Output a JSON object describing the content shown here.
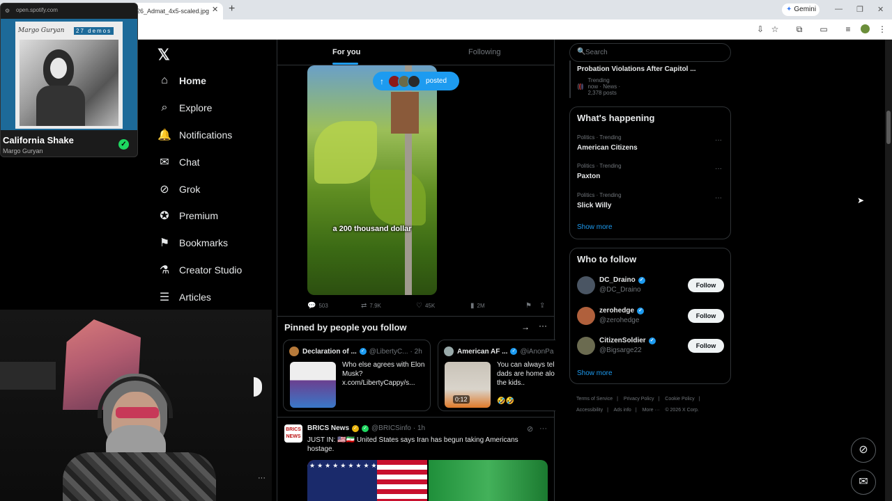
{
  "browser": {
    "active_tab_title": "26_Admat_4x5-scaled.jpg",
    "gemini_label": "Gemini"
  },
  "mini_player": {
    "url": "open.spotify.com",
    "album_title": "Margo Guryan",
    "album_badge": "27 demos",
    "track": "California Shake",
    "artist": "Margo Guryan"
  },
  "nav": {
    "items": [
      {
        "label": "Home",
        "icon": "home-icon"
      },
      {
        "label": "Explore",
        "icon": "search-icon"
      },
      {
        "label": "Notifications",
        "icon": "bell-icon"
      },
      {
        "label": "Chat",
        "icon": "mail-icon"
      },
      {
        "label": "Grok",
        "icon": "grok-icon"
      },
      {
        "label": "Premium",
        "icon": "verified-icon"
      },
      {
        "label": "Bookmarks",
        "icon": "bookmark-icon"
      },
      {
        "label": "Creator Studio",
        "icon": "flask-icon"
      },
      {
        "label": "Articles",
        "icon": "article-icon"
      }
    ]
  },
  "feed": {
    "tabs": [
      "For you",
      "Following"
    ],
    "posted_pill": "posted",
    "video_caption": "a 200 thousand dollar",
    "actions": {
      "replies": "503",
      "reposts": "7.9K",
      "likes": "45K",
      "views": "2M"
    },
    "pinned_title": "Pinned by people you follow",
    "pinned_cards": [
      {
        "name": "Declaration of ...",
        "handle": "@LibertyC...",
        "time": "· 2h",
        "text": "Who else agrees with Elon Musk? x.com/LibertyCappy/s..."
      },
      {
        "name": "American AF ...",
        "handle": "@iAnonPa",
        "text": "You can always tel dads are home alo the kids..",
        "video_time": "0:12",
        "emoji": "🤣🤣"
      }
    ],
    "brics": {
      "name": "BRICS News",
      "handle": "@BRICSinfo",
      "time": "· 1h",
      "avatar_text": "BRICS NEWS",
      "text": "JUST IN: 🇺🇸🇮🇷 United States says Iran has begun taking Americans hostage."
    }
  },
  "right": {
    "search_placeholder": "Search",
    "news": {
      "title": "Probation Violations After Capitol ...",
      "meta": "Trending now · News · 2,378 posts"
    },
    "whats_happening_title": "What's happening",
    "trends": [
      {
        "category": "Politics · Trending",
        "name": "American Citizens"
      },
      {
        "category": "Politics · Trending",
        "name": "Paxton"
      },
      {
        "category": "Politics · Trending",
        "name": "Slick Willy"
      }
    ],
    "show_more": "Show more",
    "who_to_follow_title": "Who to follow",
    "follow_suggestions": [
      {
        "name": "DC_Draino",
        "handle": "@DC_Draino"
      },
      {
        "name": "zerohedge",
        "handle": "@zerohedge"
      },
      {
        "name": "CitizenSoldier",
        "handle": "@Bigsarge22"
      }
    ],
    "follow_label": "Follow",
    "footer": [
      "Terms of Service",
      "|",
      "Privacy Policy",
      "|",
      "Cookie Policy",
      "|",
      "Accessibility",
      "|",
      "Ads info",
      "|",
      "More ···",
      "© 2026 X Corp."
    ]
  }
}
